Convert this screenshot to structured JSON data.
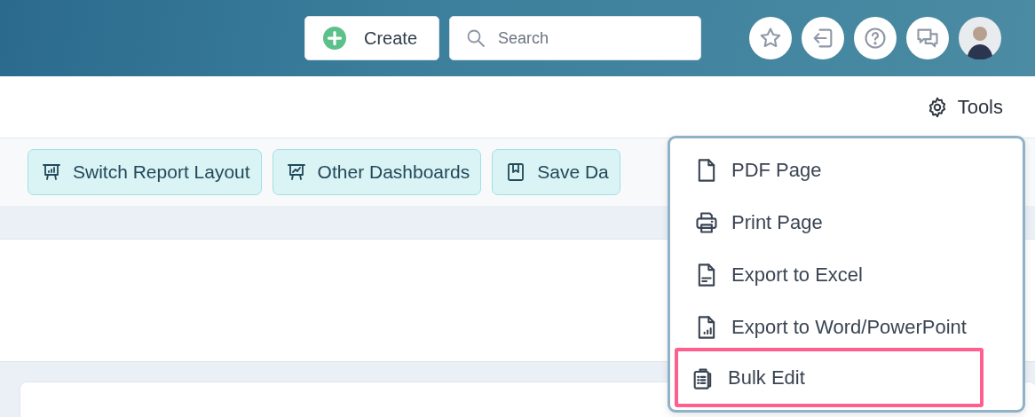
{
  "header": {
    "create_button": "Create",
    "search": {
      "placeholder": "Search"
    },
    "icons": [
      {
        "kind": "star"
      },
      {
        "kind": "logout"
      },
      {
        "kind": "help"
      },
      {
        "kind": "chat"
      },
      {
        "kind": "avatar"
      }
    ]
  },
  "tools_button": "Tools",
  "toolbar": [
    {
      "kind": "report",
      "label": "Switch Report Layout"
    },
    {
      "kind": "dashboard",
      "label": "Other Dashboards"
    },
    {
      "kind": "bookmark",
      "label": "Save Da"
    }
  ],
  "tools_menu": [
    {
      "kind": "pdf",
      "label": "PDF Page",
      "highlighted": false
    },
    {
      "kind": "print",
      "label": "Print Page",
      "highlighted": false
    },
    {
      "kind": "excel",
      "label": "Export to Excel",
      "highlighted": false
    },
    {
      "kind": "word",
      "label": "Export to Word/PowerPoint",
      "highlighted": false
    },
    {
      "kind": "bulk",
      "label": "Bulk Edit",
      "highlighted": true
    }
  ]
}
